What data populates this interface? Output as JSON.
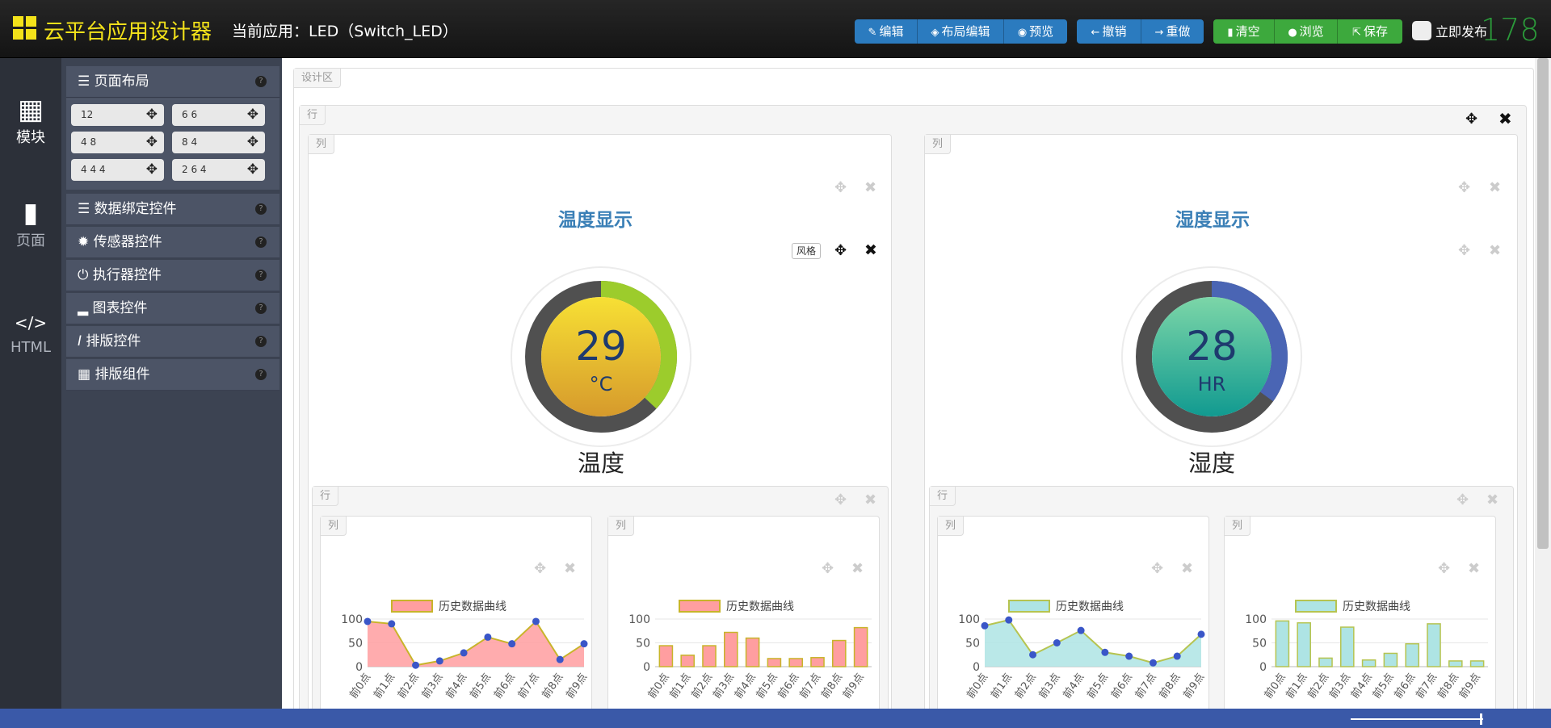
{
  "app_title": "云平台应用设计器",
  "current_app": "当前应用：LED（Switch_LED）",
  "toolbar": {
    "edit": "编辑",
    "layout_edit": "布局编辑",
    "preview": "预览",
    "undo": "撤销",
    "redo": "重做",
    "clear": "清空",
    "browse": "浏览",
    "save": "保存",
    "publish": "立即发布",
    "counter": "178"
  },
  "leftnav": {
    "modules": "模块",
    "pages": "页面",
    "html_icon": "</>",
    "html": "HTML"
  },
  "panel": {
    "layout": "页面布局",
    "grid_options": [
      "12",
      "6 6",
      "4 8",
      "8 4",
      "4 4 4",
      "2 6 4"
    ],
    "sections": [
      "数据绑定控件",
      "传感器控件",
      "执行器控件",
      "图表控件",
      "排版控件",
      "排版组件"
    ],
    "help": "?"
  },
  "design_area": "设计区",
  "row_tag": "行",
  "col_tag": "列",
  "style_btn": "风格",
  "widgets": {
    "temp": {
      "title": "温度显示",
      "value": "29",
      "unit": "°C",
      "name": "温度",
      "fraction": 0.37
    },
    "hum": {
      "title": "湿度显示",
      "value": "28",
      "unit": "HR",
      "name": "湿度",
      "fraction": 0.35
    }
  },
  "colors": {
    "temp_fill": "#ff9ea0",
    "temp_line": "#c8b42a",
    "hum_fill": "#aee4e4",
    "hum_line": "#b6c450",
    "marker": "#3a56c8",
    "temp_gauge": "#9ccc2c",
    "hum_gauge": "#4a65b4"
  },
  "chart_data": [
    {
      "type": "area",
      "series": [
        {
          "name": "历史数据曲线",
          "values": [
            95,
            90,
            3,
            12,
            29,
            62,
            48,
            95,
            15,
            48
          ]
        }
      ],
      "categories": [
        "前0点",
        "前1点",
        "前2点",
        "前3点",
        "前4点",
        "前5点",
        "前6点",
        "前7点",
        "前8点",
        "前9点"
      ],
      "yticks": [
        "0",
        "50",
        "100"
      ],
      "ylim": [
        0,
        100
      ],
      "legend": "top"
    },
    {
      "type": "bar",
      "series": [
        {
          "name": "历史数据曲线",
          "values": [
            44,
            24,
            44,
            72,
            60,
            17,
            17,
            19,
            55,
            82
          ]
        }
      ],
      "categories": [
        "前0点",
        "前1点",
        "前2点",
        "前3点",
        "前4点",
        "前5点",
        "前6点",
        "前7点",
        "前8点",
        "前9点"
      ],
      "yticks": [
        "0",
        "50",
        "100"
      ],
      "ylim": [
        0,
        100
      ],
      "legend": "top"
    },
    {
      "type": "area",
      "series": [
        {
          "name": "历史数据曲线",
          "values": [
            86,
            98,
            25,
            50,
            76,
            30,
            22,
            8,
            22,
            68
          ]
        }
      ],
      "categories": [
        "前0点",
        "前1点",
        "前2点",
        "前3点",
        "前4点",
        "前5点",
        "前6点",
        "前7点",
        "前8点",
        "前9点"
      ],
      "yticks": [
        "0",
        "50",
        "100"
      ],
      "ylim": [
        0,
        100
      ],
      "legend": "top"
    },
    {
      "type": "bar",
      "series": [
        {
          "name": "历史数据曲线",
          "values": [
            96,
            92,
            18,
            83,
            14,
            28,
            48,
            90,
            12,
            12
          ]
        }
      ],
      "categories": [
        "前0点",
        "前1点",
        "前2点",
        "前3点",
        "前4点",
        "前5点",
        "前6点",
        "前7点",
        "前8点",
        "前9点"
      ],
      "yticks": [
        "0",
        "50",
        "100"
      ],
      "ylim": [
        0,
        100
      ],
      "legend": "top"
    }
  ]
}
